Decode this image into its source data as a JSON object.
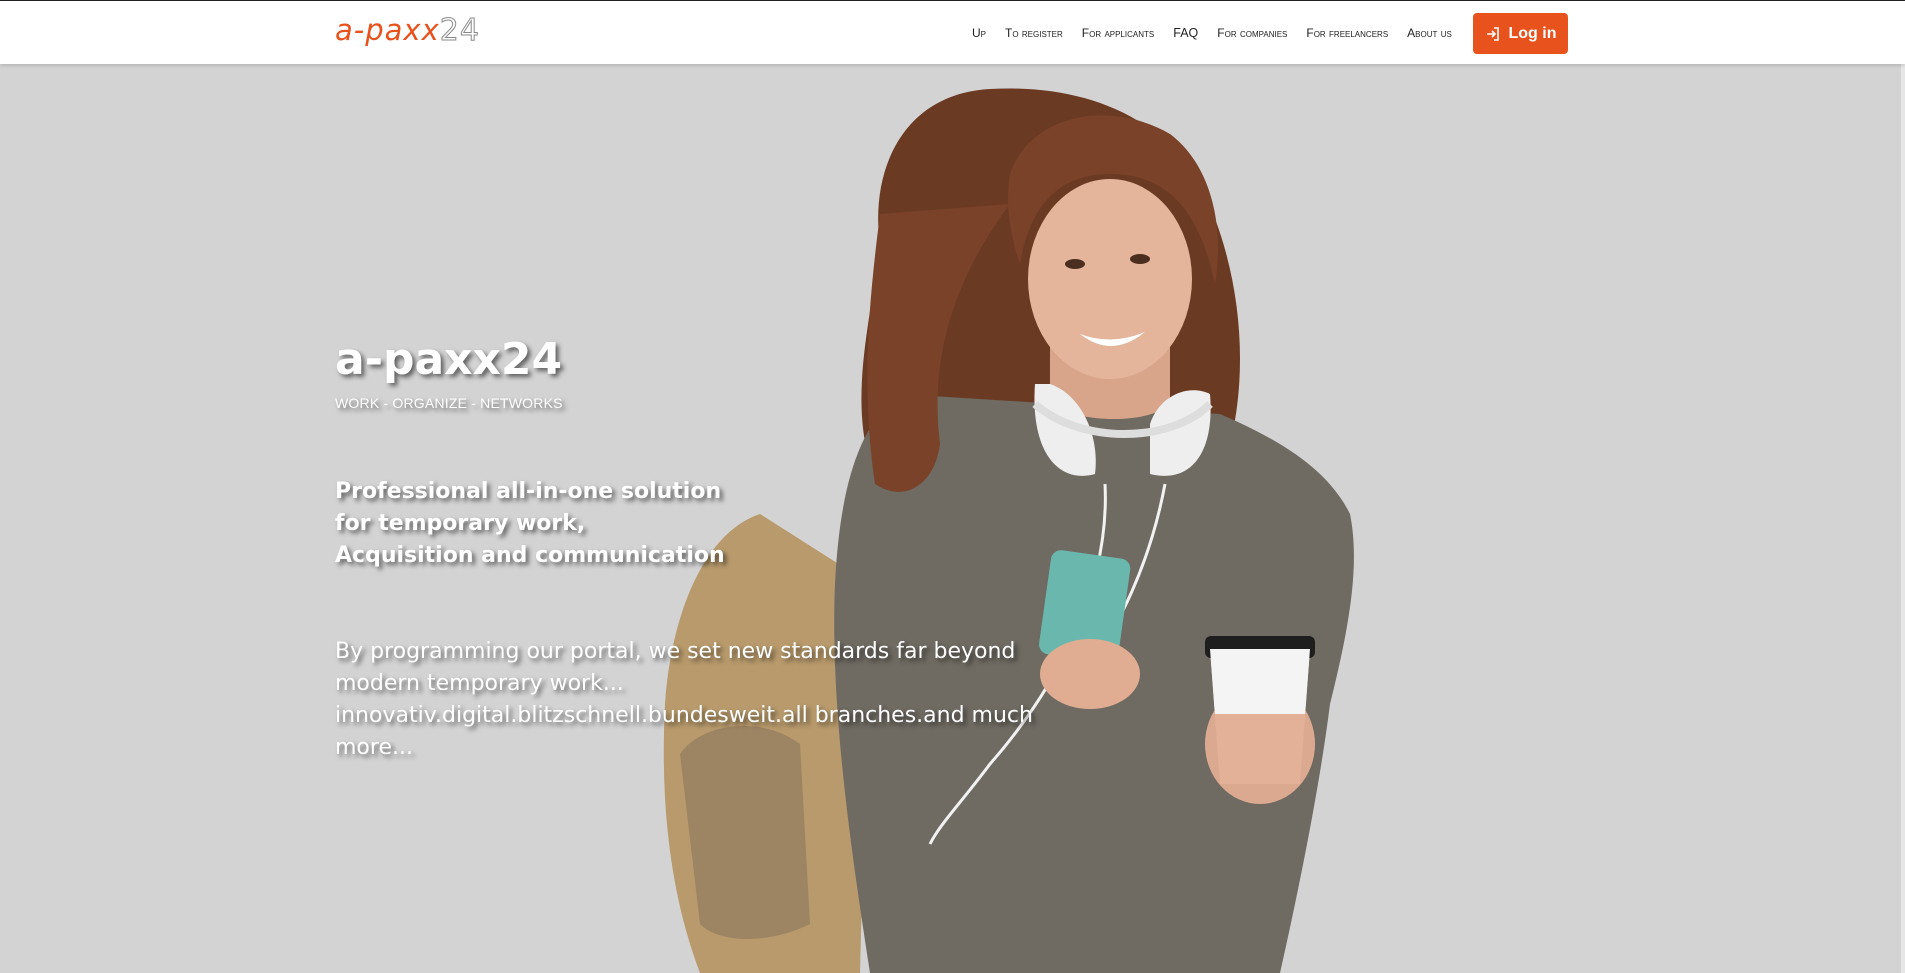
{
  "header": {
    "logo": {
      "brand": "a-paxx",
      "number": "24"
    },
    "nav": [
      {
        "label": "Up"
      },
      {
        "label": "To register"
      },
      {
        "label": "For applicants"
      },
      {
        "label": "FAQ"
      },
      {
        "label": "For companies"
      },
      {
        "label": "For freelancers"
      },
      {
        "label": "About us"
      }
    ],
    "login": {
      "label": "Log in",
      "icon": "login-icon"
    }
  },
  "hero": {
    "title": "a-paxx24",
    "subtitle": "WORK - ORGANIZE - NETWORKS",
    "tagline": [
      "Professional all-in-one solution",
      "for temporary work,",
      "Acquisition and communication"
    ],
    "body": "By programming our portal, we set new standards far beyond modern temporary work... innovativ.digital.blitzschnell.bundesweit.all branches.and much more..."
  },
  "colors": {
    "accent": "#e8521d",
    "hero_background": "#d3d3d3",
    "header_background": "#ffffff"
  }
}
